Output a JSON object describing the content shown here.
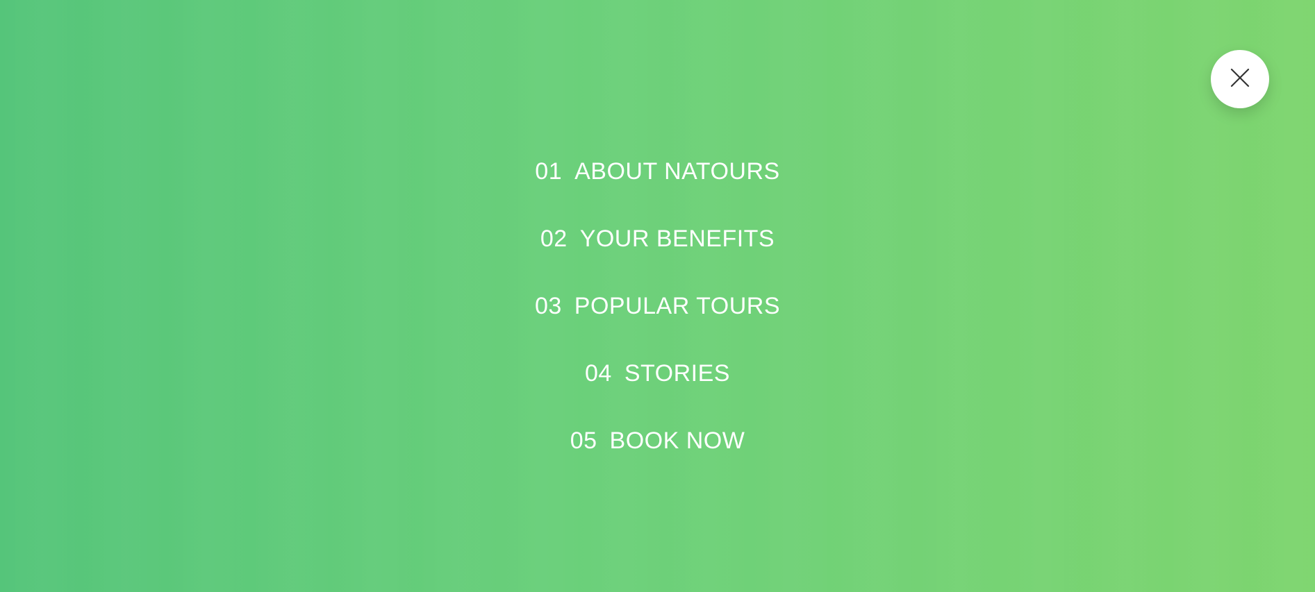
{
  "close_button": {
    "icon": "close-icon"
  },
  "nav": {
    "items": [
      {
        "number": "01",
        "label": "ABOUT NATOURS"
      },
      {
        "number": "02",
        "label": "YOUR BENEFITS"
      },
      {
        "number": "03",
        "label": "POPULAR TOURS"
      },
      {
        "number": "04",
        "label": "STORIES"
      },
      {
        "number": "05",
        "label": "BOOK NOW"
      }
    ]
  },
  "colors": {
    "gradient_start": "#55c57a",
    "gradient_end": "#7ed56f",
    "text": "#ffffff",
    "button_bg": "#ffffff",
    "icon": "#333333"
  }
}
